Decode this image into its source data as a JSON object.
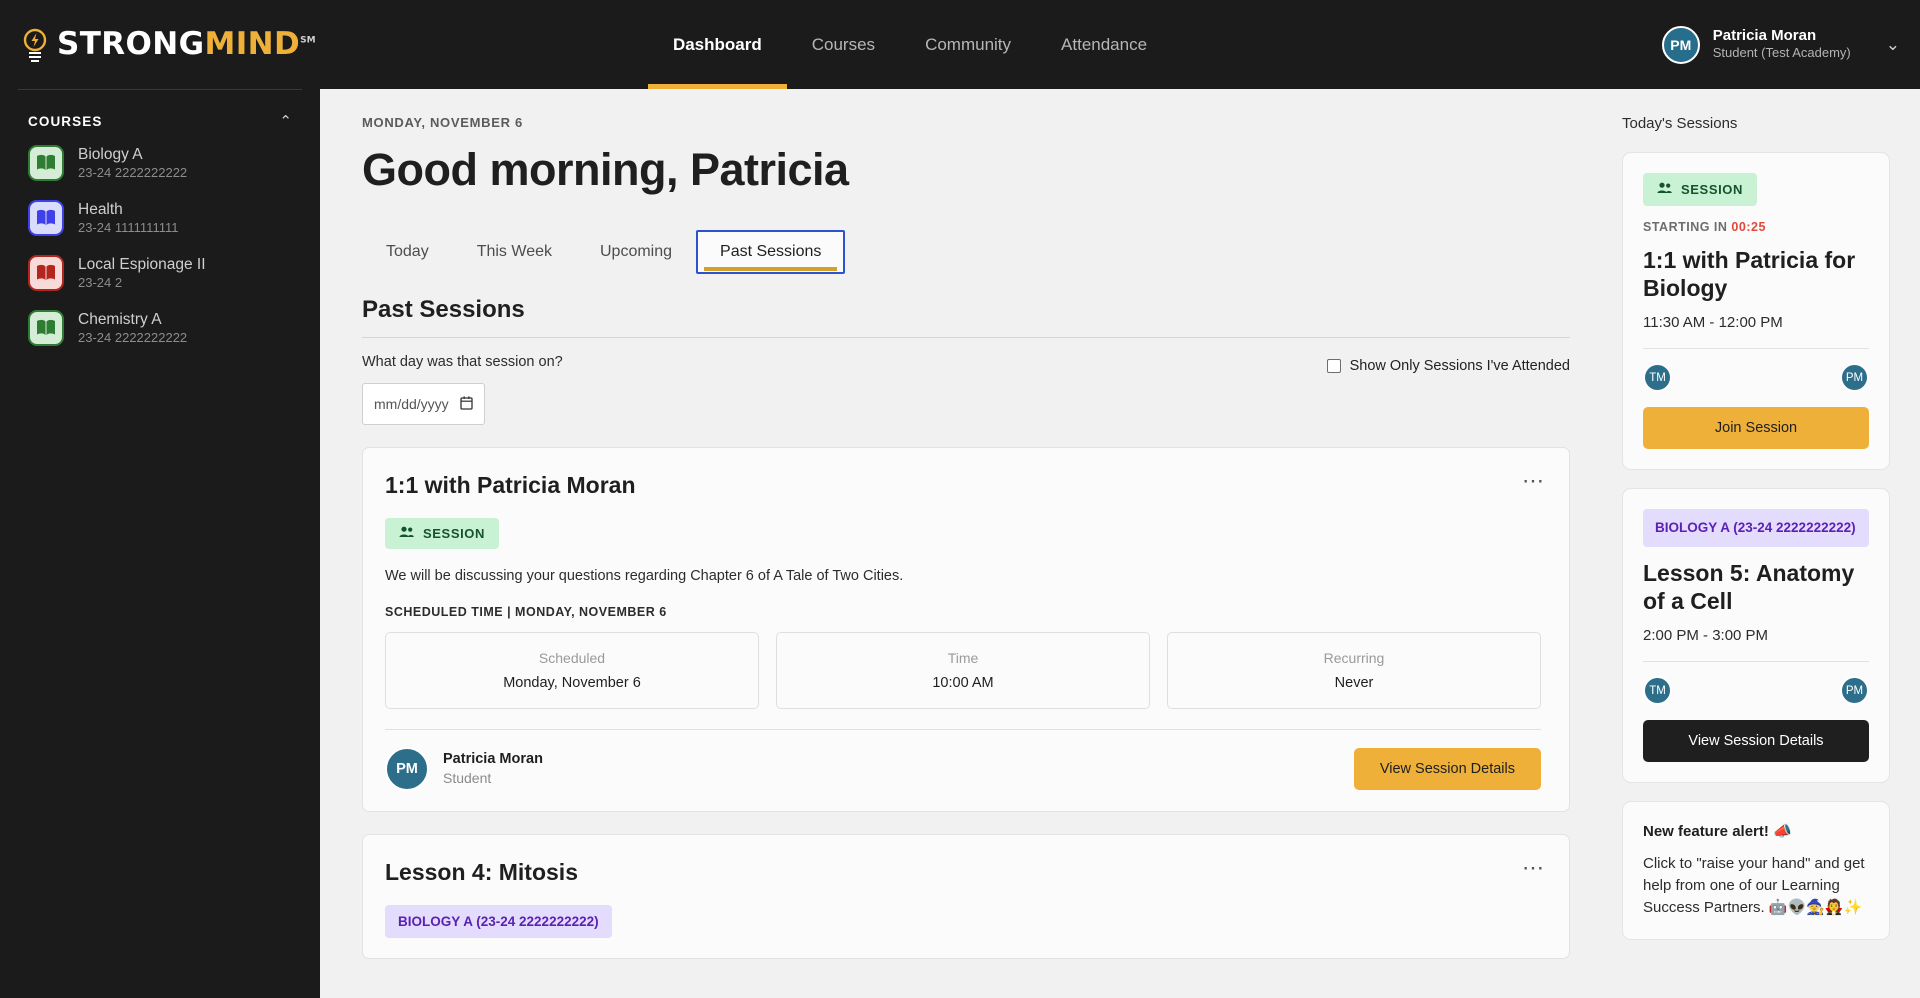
{
  "brand": {
    "name_part1": "STRONG",
    "name_part2": "MIND",
    "trademark": "SM",
    "accent_color": "#eeb038",
    "logo_icon": "lightbulb-icon"
  },
  "nav": {
    "items": [
      {
        "label": "Dashboard",
        "active": true
      },
      {
        "label": "Courses",
        "active": false
      },
      {
        "label": "Community",
        "active": false
      },
      {
        "label": "Attendance",
        "active": false
      }
    ]
  },
  "user": {
    "initials": "PM",
    "name": "Patricia Moran",
    "role": "Student (Test Academy)",
    "chevron": "⌄"
  },
  "sidebar": {
    "section_title": "COURSES",
    "collapse_icon": "chevron-up-icon",
    "collapse_glyph": "⌃",
    "items": [
      {
        "name": "Biology A",
        "code": "23-24 2222222222",
        "color": "green"
      },
      {
        "name": "Health",
        "code": "23-24 1111111111",
        "color": "blue"
      },
      {
        "name": "Local Espionage II",
        "code": "23-24 2",
        "color": "red"
      },
      {
        "name": "Chemistry A",
        "code": "23-24 2222222222",
        "color": "green"
      }
    ]
  },
  "main": {
    "date_stamp": "MONDAY, NOVEMBER 6",
    "greeting": "Good morning, Patricia",
    "tabs": [
      {
        "label": "Today",
        "active": false
      },
      {
        "label": "This Week",
        "active": false
      },
      {
        "label": "Upcoming",
        "active": false
      },
      {
        "label": "Past Sessions",
        "active": true
      }
    ],
    "section_title": "Past Sessions",
    "filters": {
      "date_question": "What day was that session on?",
      "date_placeholder": "mm/dd/yyyy",
      "calendar_icon": "calendar-icon",
      "checkbox_label": "Show Only Sessions I've Attended",
      "checkbox_checked": false
    },
    "sessions": [
      {
        "title": "1:1 with Patricia Moran",
        "badge_type": "session",
        "badge_label": "SESSION",
        "description": "We will be discussing your questions regarding Chapter 6 of A Tale of Two Cities.",
        "scheduled_heading": "SCHEDULED TIME | MONDAY, NOVEMBER 6",
        "info": [
          {
            "label": "Scheduled",
            "value": "Monday, November 6"
          },
          {
            "label": "Time",
            "value": "10:00 AM"
          },
          {
            "label": "Recurring",
            "value": "Never"
          }
        ],
        "person": {
          "initials": "PM",
          "name": "Patricia Moran",
          "role": "Student"
        },
        "action_label": "View Session Details",
        "menu_glyph": "⋯"
      },
      {
        "title": "Lesson 4: Mitosis",
        "badge_type": "course",
        "badge_label": "BIOLOGY A (23-24 2222222222)",
        "menu_glyph": "⋯"
      }
    ]
  },
  "rail": {
    "title": "Today's Sessions",
    "cards": [
      {
        "kind": "session",
        "badge_label": "SESSION",
        "people_icon": "people-icon",
        "starting_prefix": "STARTING IN",
        "countdown": "00:25",
        "title": "1:1 with Patricia for Biology",
        "time": "11:30 AM - 12:00 PM",
        "avatars": [
          "TM",
          "PM"
        ],
        "action_label": "Join Session",
        "action_style": "gold"
      },
      {
        "kind": "course",
        "badge_label": "BIOLOGY A (23-24 2222222222)",
        "title": "Lesson 5: Anatomy of a Cell",
        "time": "2:00 PM - 3:00 PM",
        "avatars": [
          "TM",
          "PM"
        ],
        "action_label": "View Session Details",
        "action_style": "dark"
      }
    ],
    "alert": {
      "title": "New feature alert! 📣",
      "body": "Click to \"raise your hand\" and get help from one of our Learning Success Partners. 🤖👽🧙🧛✨"
    }
  }
}
